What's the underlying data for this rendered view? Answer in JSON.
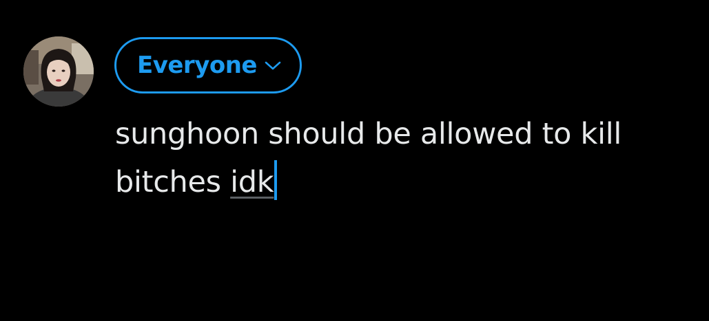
{
  "composer": {
    "avatar_icon": "user-avatar",
    "audience": {
      "label": "Everyone",
      "icon": "chevron-down-icon",
      "color": "#1d9bf0"
    },
    "text": {
      "line1": "sunghoon should be allowed to kill",
      "line2_prefix": "bitches ",
      "line2_flagged_word": "idk"
    },
    "caret_color": "#1d9bf0",
    "text_color": "#e7e9ea"
  }
}
